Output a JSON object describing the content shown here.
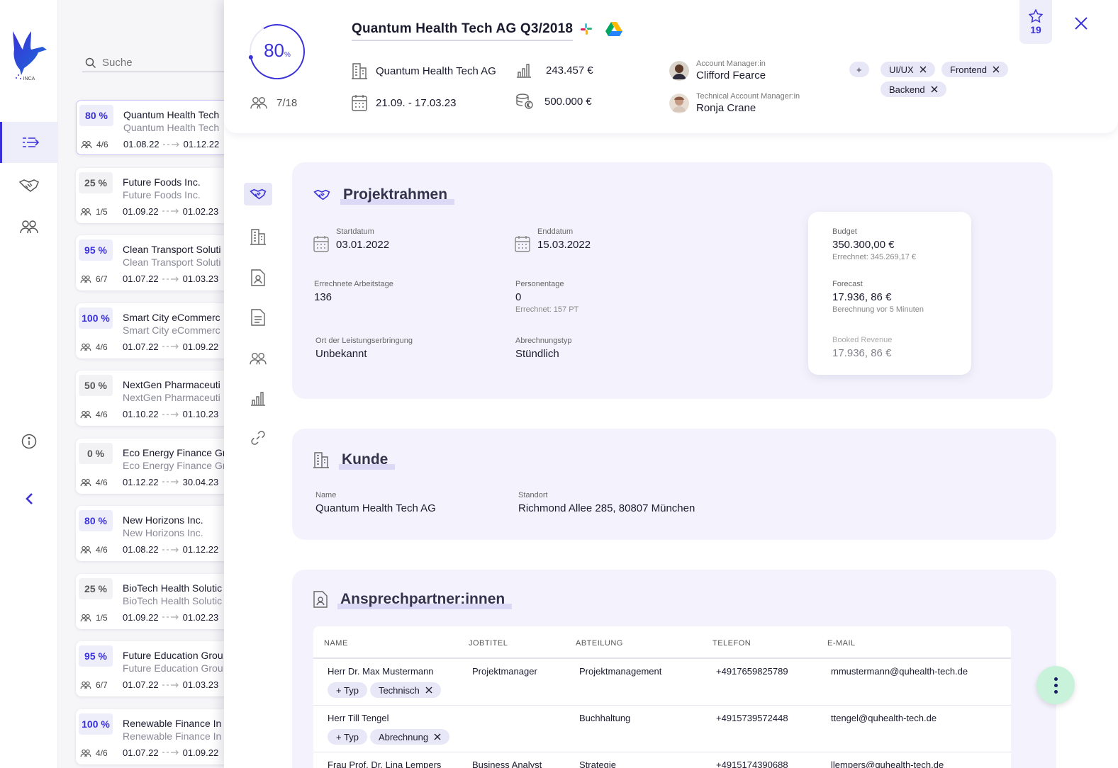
{
  "app": {
    "logo_text": "INCA",
    "accent": "#3a31d8"
  },
  "rail": {
    "nav": [
      "projects-nav",
      "deals-nav",
      "team-nav",
      "info-nav",
      "collapse-nav"
    ]
  },
  "search": {
    "placeholder": "Suche"
  },
  "projects": [
    {
      "pct": "80 %",
      "name": "Quantum Health Tech",
      "client": "Quantum Health Tech",
      "team": "4/6",
      "start": "01.08.22",
      "end": "01.12.22",
      "active": true
    },
    {
      "pct": "25 %",
      "name": "Future Foods Inc.",
      "client": "Future Foods Inc.",
      "team": "1/5",
      "start": "01.09.22",
      "end": "01.02.23"
    },
    {
      "pct": "95 %",
      "name": "Clean Transport Soluti",
      "client": "Clean Transport Soluti",
      "team": "6/7",
      "start": "01.07.22",
      "end": "01.03.23"
    },
    {
      "pct": "100 %",
      "name": "Smart City eCommerc",
      "client": "Smart City eCommerc",
      "team": "4/6",
      "start": "01.07.22",
      "end": "01.09.22"
    },
    {
      "pct": "50 %",
      "name": "NextGen Pharmaceuti",
      "client": "NextGen Pharmaceuti",
      "team": "4/6",
      "start": "01.10.22",
      "end": "01.10.23"
    },
    {
      "pct": "0 %",
      "name": "Eco Energy Finance Gr",
      "client": "Eco Energy Finance Gr",
      "team": "4/6",
      "start": "01.12.22",
      "end": "30.04.23"
    },
    {
      "pct": "80 %",
      "name": "New Horizons Inc.",
      "client": "New Horizons Inc.",
      "team": "4/6",
      "start": "01.08.22",
      "end": "01.12.22"
    },
    {
      "pct": "25 %",
      "name": "BioTech Health Solutic",
      "client": "BioTech Health Solutic",
      "team": "1/5",
      "start": "01.09.22",
      "end": "01.02.23"
    },
    {
      "pct": "95 %",
      "name": "Future Education Grou",
      "client": "Future Education Grou",
      "team": "6/7",
      "start": "01.07.22",
      "end": "01.03.23"
    },
    {
      "pct": "100 %",
      "name": "Renewable Finance In",
      "client": "Renewable Finance In",
      "team": "4/6",
      "start": "01.07.22",
      "end": "01.09.22"
    }
  ],
  "detail": {
    "progress_value": "80",
    "progress_unit": "%",
    "progress_fraction": 0.8,
    "team_count": "7/18",
    "title": "Quantum Health Tech AG Q3/2018",
    "company": "Quantum Health Tech AG",
    "period": "21.09. - 17.03.23",
    "revenue": "243.457 €",
    "budget": "500.000 €",
    "account_manager_role": "Account Manager:in",
    "account_manager": "Clifford Fearce",
    "tech_manager_role": "Technical Account Manager:in",
    "tech_manager": "Ronja Crane",
    "add_tag": "+",
    "tags": [
      "UI/UX",
      "Frontend",
      "Backend"
    ],
    "favorites": "19"
  },
  "projektrahmen": {
    "title": "Projektrahmen",
    "start_label": "Startdatum",
    "start": "03.01.2022",
    "end_label": "Enddatum",
    "end": "15.03.2022",
    "workdays_label": "Errechnete Arbeitstage",
    "workdays": "136",
    "persondays_label": "Personentage",
    "persondays": "0",
    "persondays_sub": "Errechnet: 157 PT",
    "location_label": "Ort der Leistungserbringung",
    "location": "Unbekannt",
    "billing_label": "Abrechnungstyp",
    "billing": "Stündlich",
    "budget_label": "Budget",
    "budget": "350.300,00 €",
    "budget_sub": "Errechnet: 345.269,17 €",
    "forecast_label": "Forecast",
    "forecast": "17.936, 86 €",
    "forecast_sub": "Berechnung vor 5 Minuten",
    "booked_label": "Booked Revenue",
    "booked": "17.936, 86 €"
  },
  "kunde": {
    "title": "Kunde",
    "name_label": "Name",
    "name": "Quantum Health Tech AG",
    "location_label": "Standort",
    "location": "Richmond Allee 285, 80807 München"
  },
  "contacts": {
    "title": "Ansprechpartner:innen",
    "headers": [
      "NAME",
      "JOBTITEL",
      "ABTEILUNG",
      "TELEFON",
      "E-MAIL"
    ],
    "rows": [
      {
        "name": "Herr Dr. Max Mustermann",
        "job": "Projektmanager",
        "dept": "Projektmanagement",
        "phone": "+4917659825789",
        "email": "mmustermann@quhealth-tech.de",
        "add": "+ Typ",
        "type": "Technisch"
      },
      {
        "name": "Herr Till Tengel",
        "job": "",
        "dept": "Buchhaltung",
        "phone": "+4915739572448",
        "email": "ttengel@quhealth-tech.de",
        "add": "+ Typ",
        "type": "Abrechnung"
      },
      {
        "name": "Frau Prof. Dr. Lina Lempers",
        "job": "Business Analyst",
        "dept": "Strategie",
        "phone": "+4915174390688",
        "email": "llempers@quhealth-tech.de",
        "add": "",
        "type": ""
      }
    ]
  }
}
